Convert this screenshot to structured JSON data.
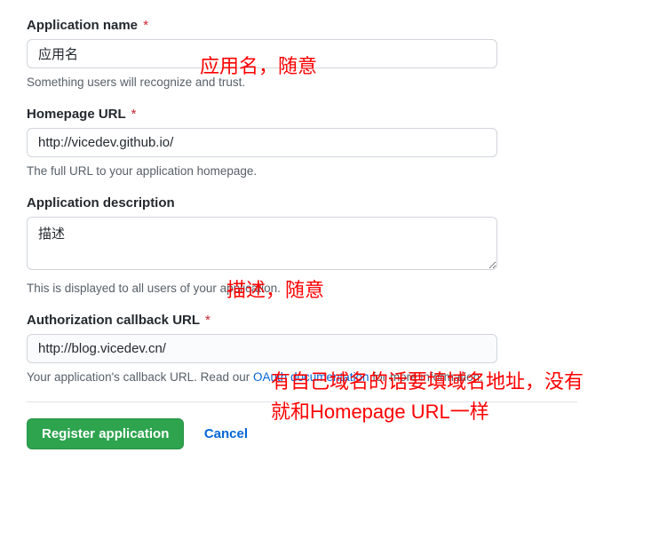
{
  "appName": {
    "label": "Application name",
    "value": "应用名",
    "hint": "Something users will recognize and trust."
  },
  "homepage": {
    "label": "Homepage URL",
    "value": "http://vicedev.github.io/",
    "hint": "The full URL to your application homepage."
  },
  "description": {
    "label": "Application description",
    "value": "描述",
    "hint": "This is displayed to all users of your application."
  },
  "callback": {
    "label": "Authorization callback URL",
    "value": "http://blog.vicedev.cn/",
    "hintPrefix": "Your application's callback URL. Read our ",
    "hintLink": "OAuth documentation",
    "hintSuffix": " for more information."
  },
  "requiredMark": "*",
  "buttons": {
    "register": "Register application",
    "cancel": "Cancel"
  },
  "annotations": {
    "appName": "应用名，随意",
    "description": "描述，随意",
    "callback": "有自己域名的话要填域名地址，没有就和Homepage URL一样"
  }
}
